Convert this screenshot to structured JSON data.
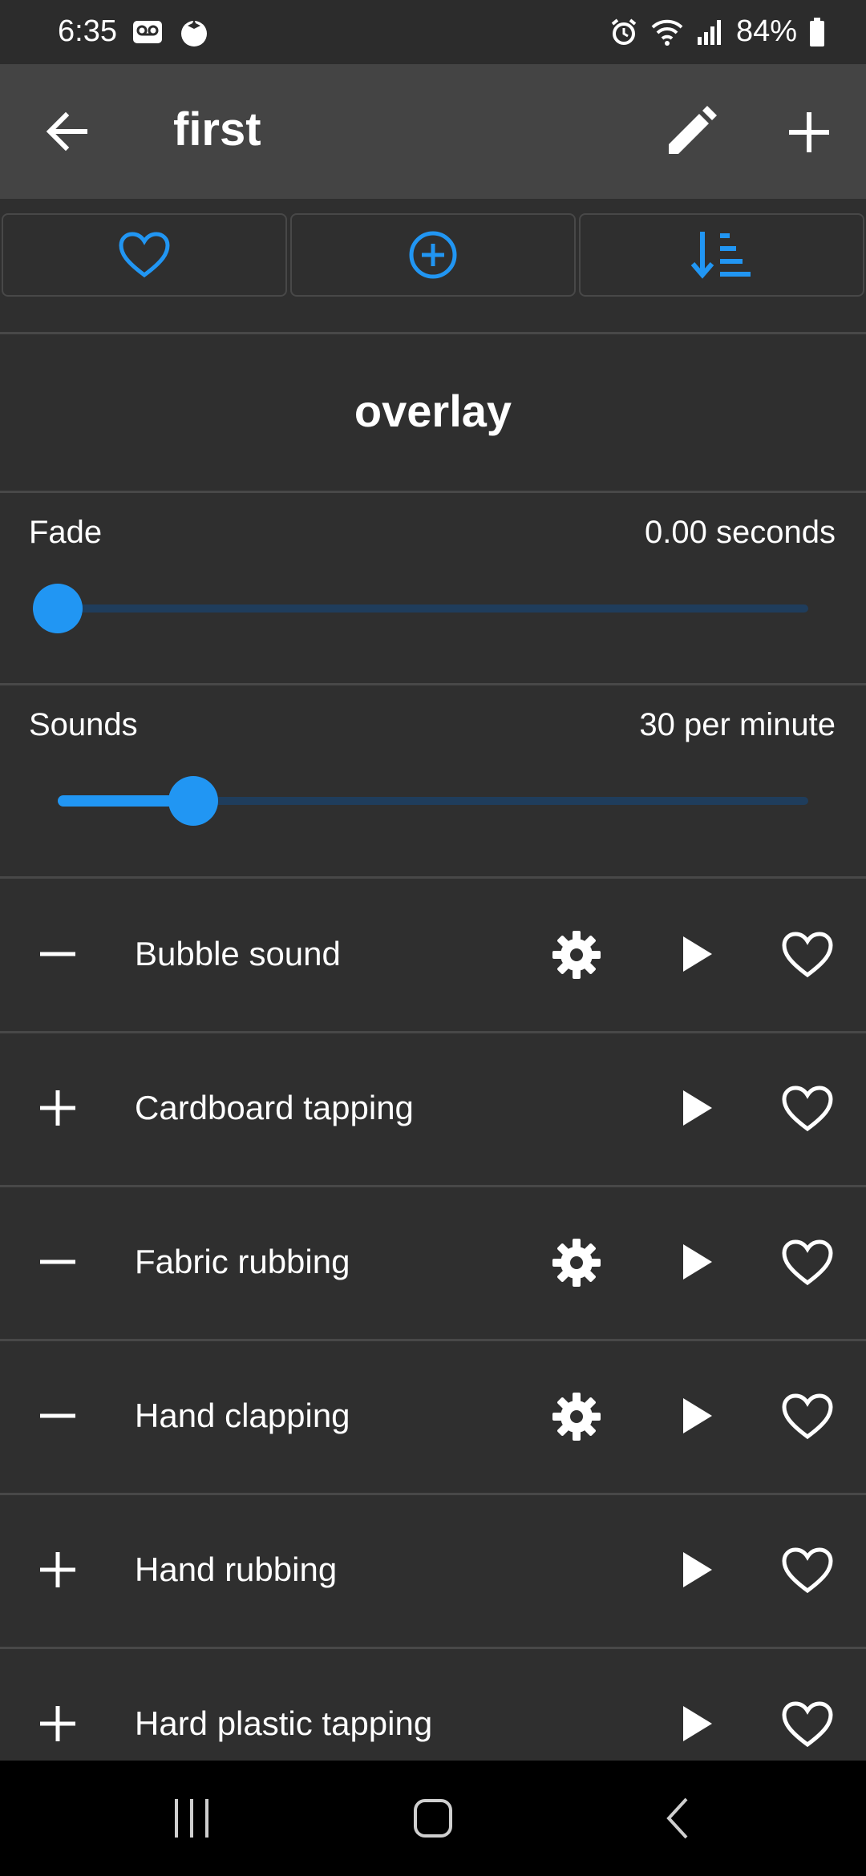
{
  "status": {
    "time": "6:35",
    "battery": "84%"
  },
  "appbar": {
    "title": "first"
  },
  "section": {
    "title": "overlay"
  },
  "fade": {
    "label": "Fade",
    "value": "0.00 seconds",
    "level": 0.0
  },
  "sounds_rate": {
    "label": "Sounds",
    "value": "30 per minute",
    "level": 0.18
  },
  "sounds": [
    {
      "name": "Bubble sound",
      "sign": "minus",
      "has_settings": true
    },
    {
      "name": "Cardboard tapping",
      "sign": "plus",
      "has_settings": false
    },
    {
      "name": "Fabric rubbing",
      "sign": "minus",
      "has_settings": true
    },
    {
      "name": "Hand clapping",
      "sign": "minus",
      "has_settings": true
    },
    {
      "name": "Hand rubbing",
      "sign": "plus",
      "has_settings": false
    },
    {
      "name": "Hard plastic tapping",
      "sign": "plus",
      "has_settings": false
    }
  ],
  "colors": {
    "accent": "#2196f3",
    "background": "#2f2f2f",
    "appbar": "#444444"
  }
}
